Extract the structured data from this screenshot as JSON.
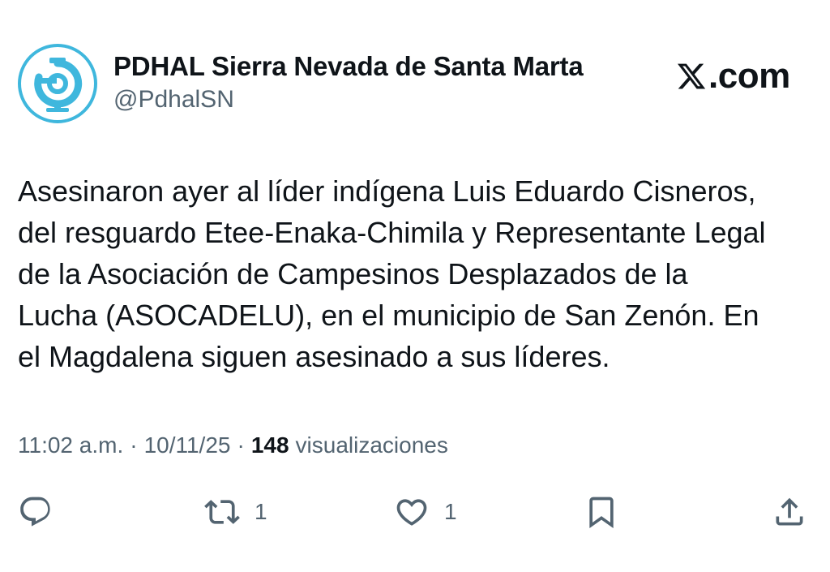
{
  "account": {
    "display_name": "PDHAL Sierra Nevada de Santa Marta",
    "handle": "@PdhalSN",
    "avatar_icon": "pdhal-logo-icon",
    "avatar_color": "#3fb7dd"
  },
  "brand": {
    "text": ".com",
    "icon": "x-logo-icon"
  },
  "tweet": {
    "text": "Asesinaron ayer al líder indígena Luis Eduardo Cisneros,\ndel resguardo Etee-Enaka-Chimila y Representante Legal\nde la Asociación de Campesinos Desplazados de la\nLucha (ASOCADELU), en el municipio de San Zenón. En\nel Magdalena siguen asesinado a sus líderes."
  },
  "meta": {
    "time": "11:02 a.m.",
    "separator": "·",
    "date": "10/11/25",
    "views_count": "148",
    "views_label": "visualizaciones"
  },
  "actions": {
    "reply": {
      "icon": "reply-icon"
    },
    "retweet": {
      "icon": "retweet-icon",
      "count": "1"
    },
    "like": {
      "icon": "heart-icon",
      "count": "1"
    },
    "bookmark": {
      "icon": "bookmark-icon"
    },
    "share": {
      "icon": "share-icon"
    }
  },
  "colors": {
    "text": "#0f1419",
    "secondary": "#536471",
    "accent": "#3fb7dd"
  }
}
